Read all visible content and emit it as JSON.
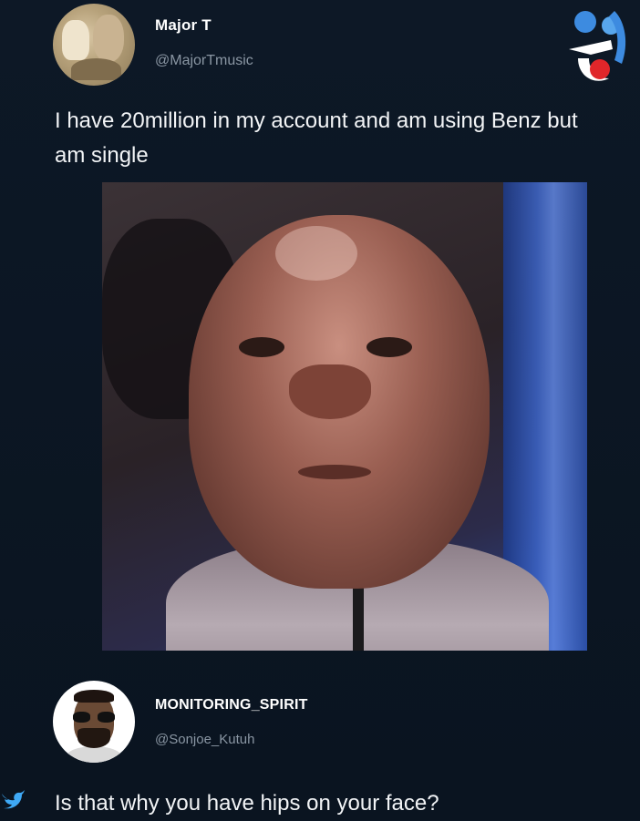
{
  "tweet": {
    "author_name": "Major T",
    "author_handle": "@MajorTmusic",
    "text": "I have 20million in my account and am using Benz but am single"
  },
  "reply": {
    "author_name": "MONITORING_SPIRIT",
    "author_handle": "@Sonjoe_Kutuh",
    "text": "Is that why you have hips on your face?"
  },
  "icons": {
    "logo": "watermark-logo-icon",
    "twitter": "twitter-bird-icon"
  },
  "colors": {
    "background": "#0b1623",
    "text": "#f2f4f6",
    "handle": "#8a96a3",
    "logo_blue": "#3d8be0",
    "logo_red": "#e0262a"
  }
}
